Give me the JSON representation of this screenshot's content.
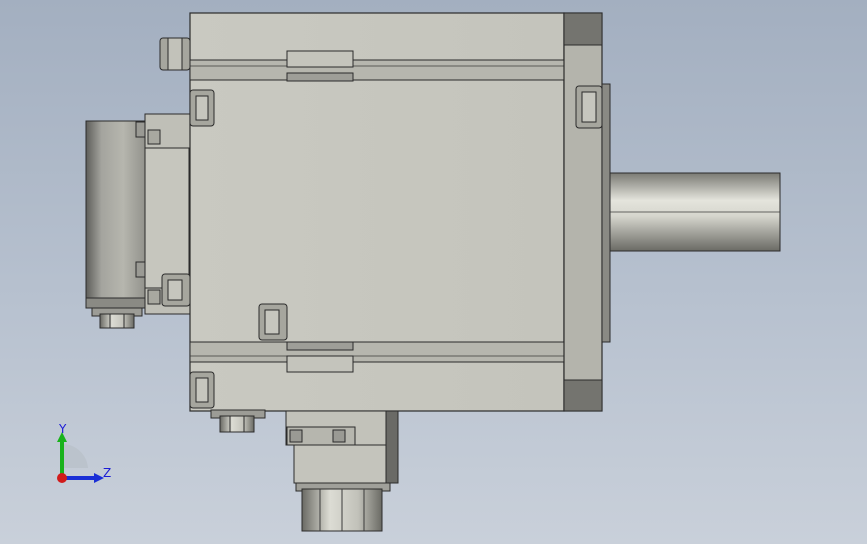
{
  "view": {
    "background_top": "#a3afc0",
    "background_bottom": "#c9d0da"
  },
  "triad": {
    "y_label": "Y",
    "z_label": "Z",
    "y_color": "#19b21b",
    "z_color": "#1a2fd6",
    "x_color": "#d11b1b"
  },
  "colors": {
    "body": "#c8c8c0",
    "body_shade": "#b9b9b1",
    "flange": "#b2b2aa",
    "flange_dark": "#6f6f6b",
    "edge": "#2b2b2b",
    "shaft_light": "#e2e2da",
    "shaft_dark": "#6e6e68"
  }
}
